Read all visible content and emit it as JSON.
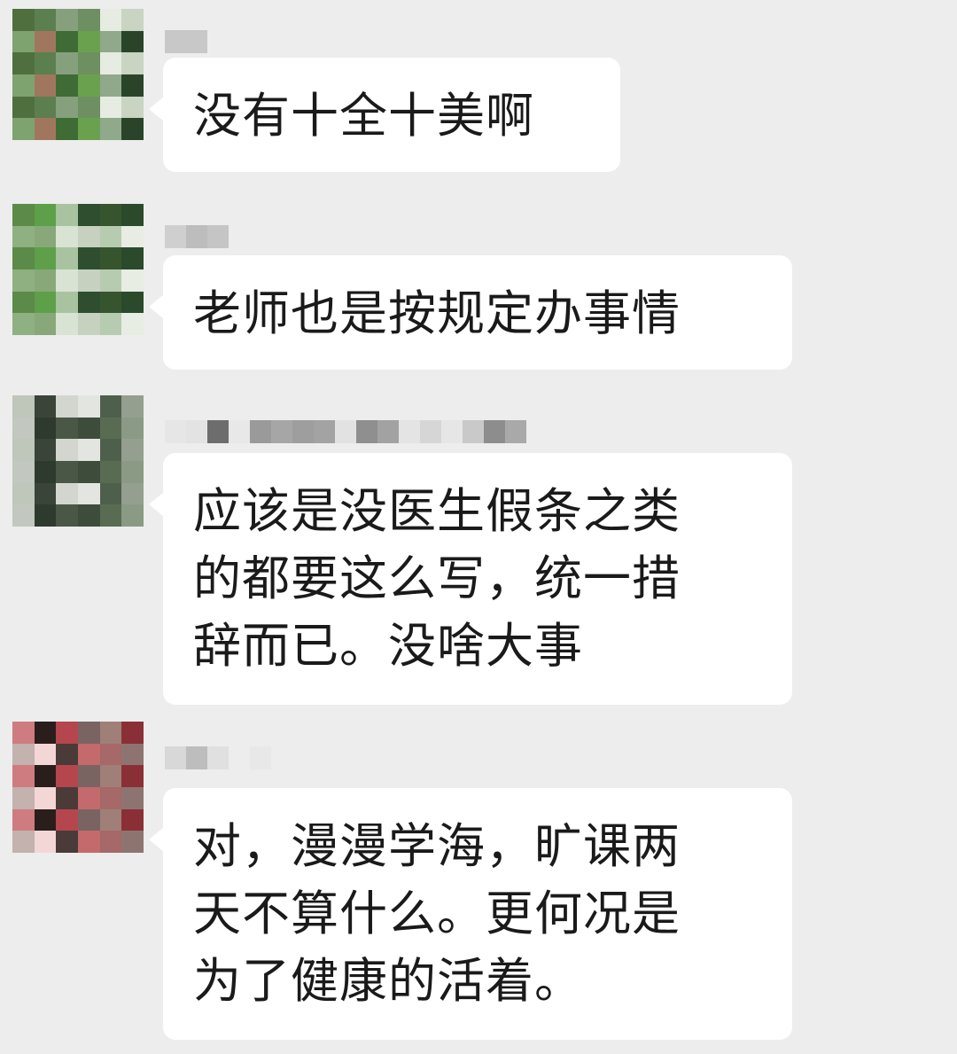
{
  "chat": {
    "messages": [
      {
        "sender_name": "",
        "lines": [
          "没有十全十美啊"
        ]
      },
      {
        "sender_name": "",
        "lines": [
          "老师也是按规定办事情"
        ]
      },
      {
        "sender_name": "",
        "lines": [
          "应该是没医生假条之类",
          "的都要这么写，统一措",
          "辞而已。没啥大事"
        ]
      },
      {
        "sender_name": "",
        "lines": [
          "对，漫漫学海，旷课两",
          "天不算什么。更何况是",
          "为了健康的活着。"
        ]
      }
    ]
  },
  "colors": {
    "background": "#ededed",
    "bubble": "#ffffff",
    "text": "#1a1a1a"
  }
}
